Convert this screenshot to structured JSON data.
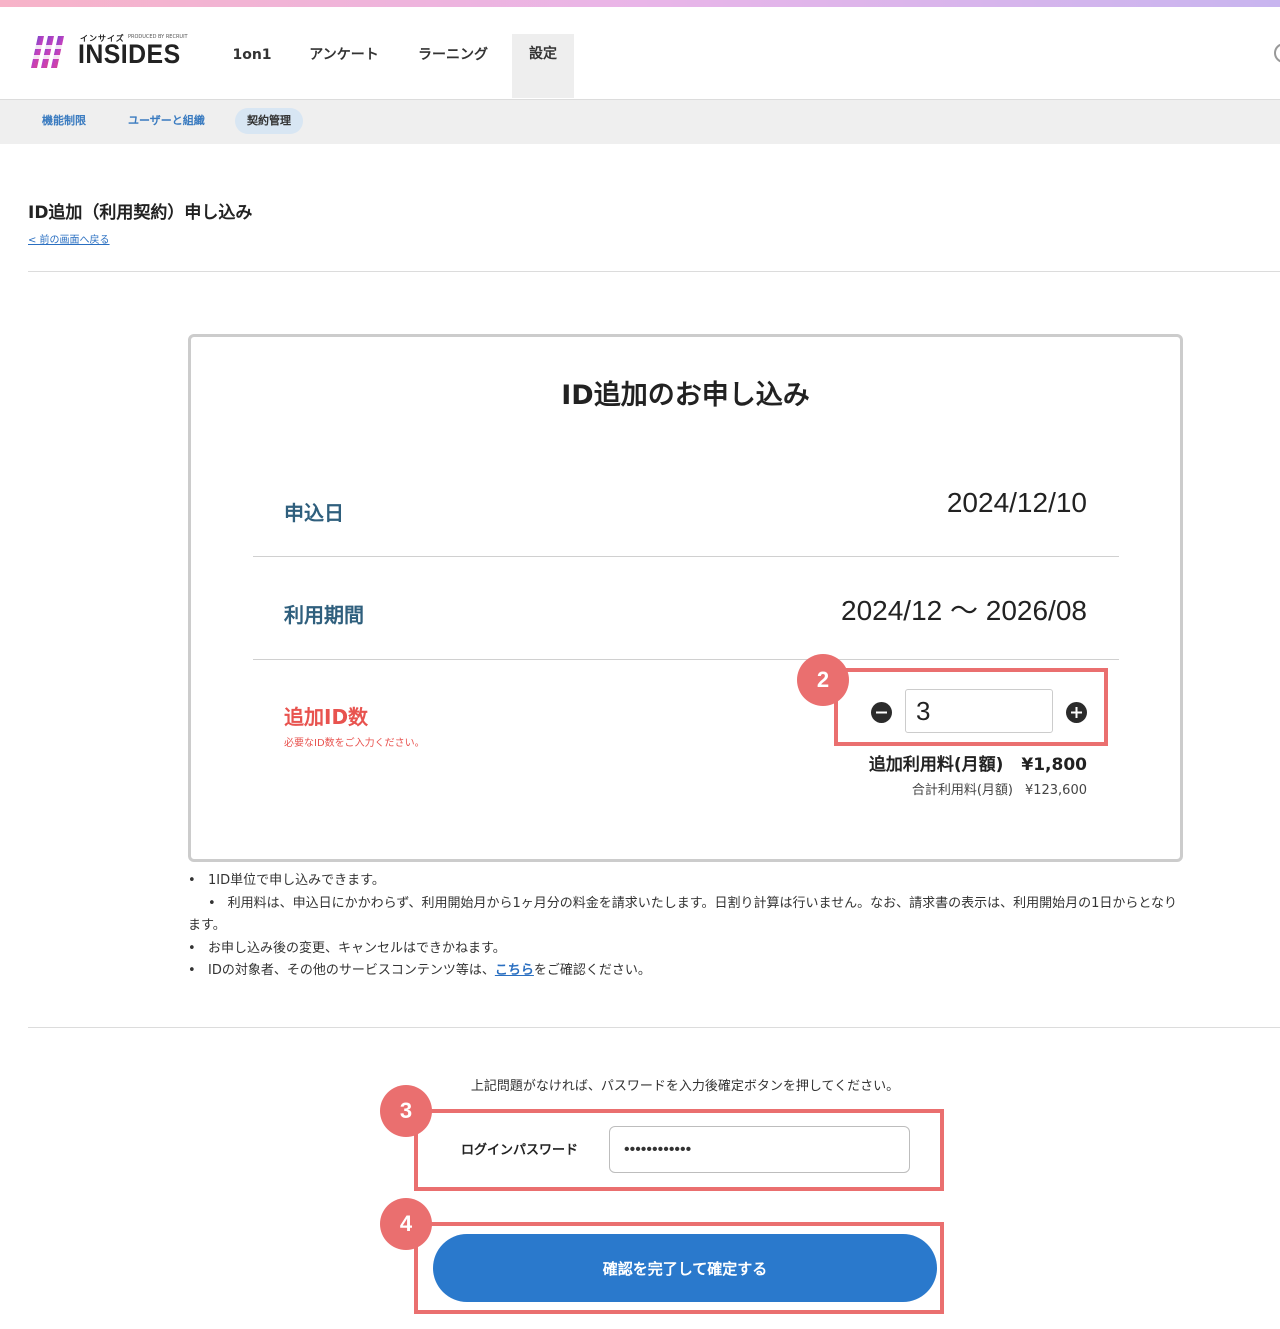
{
  "header": {
    "logo_kana": "インサイズ",
    "logo_produced": "PRODUCED BY RECRUIT",
    "logo_text": "INSIDES",
    "nav": [
      {
        "label": "1on1"
      },
      {
        "label": "アンケート"
      },
      {
        "label": "ラーニング"
      },
      {
        "label": "設定",
        "active": true
      }
    ]
  },
  "subnav": {
    "items": [
      {
        "label": "機能制限"
      },
      {
        "label": "ユーザーと組織"
      },
      {
        "label": "契約管理",
        "active": true
      }
    ]
  },
  "page": {
    "title": "ID追加（利用契約）申し込み",
    "back_link": "< 前の画面へ戻る"
  },
  "card": {
    "title": "ID追加のお申し込み",
    "application_date_label": "申込日",
    "application_date_value": "2024/12/10",
    "period_label": "利用期間",
    "period_value": "2024/12 ～ 2026/08",
    "add_ids_label": "追加ID数",
    "add_ids_hint": "必要なID数をご入力ください。",
    "add_ids_value": "3",
    "fee_label": "追加利用料(月額)",
    "fee_value": "¥1,800",
    "total_label": "合計利用料(月額)",
    "total_value": "¥123,600"
  },
  "notes": {
    "bullet": "•",
    "item1": "1ID単位で申し込みできます。",
    "item2": "利用料は、申込日にかかわらず、利用開始月から1ヶ月分の料金を請求いたします。日割り計算は行いません。なお、請求書の表示は、利用開始月の1日からとなります。",
    "item3": "お申し込み後の変更、キャンセルはできかねます。",
    "item4_before": "IDの対象者、その他のサービスコンテンツ等は、",
    "item4_link": "こちら",
    "item4_after": "をご確認ください。"
  },
  "confirm": {
    "instruction": "上記問題がなければ、パスワードを入力後確定ボタンを押してください。",
    "password_label": "ログインパスワード",
    "password_value": "••••••••••••",
    "button_label": "確認を完了して確定する"
  },
  "annotations": {
    "step2": "2",
    "step3": "3",
    "step4": "4",
    "color": "#ea6f6f"
  },
  "colors": {
    "accent": "#2a79cc",
    "label_blue": "#2f5f7d",
    "required_red": "#e8534f",
    "link": "#2a6fc1"
  }
}
